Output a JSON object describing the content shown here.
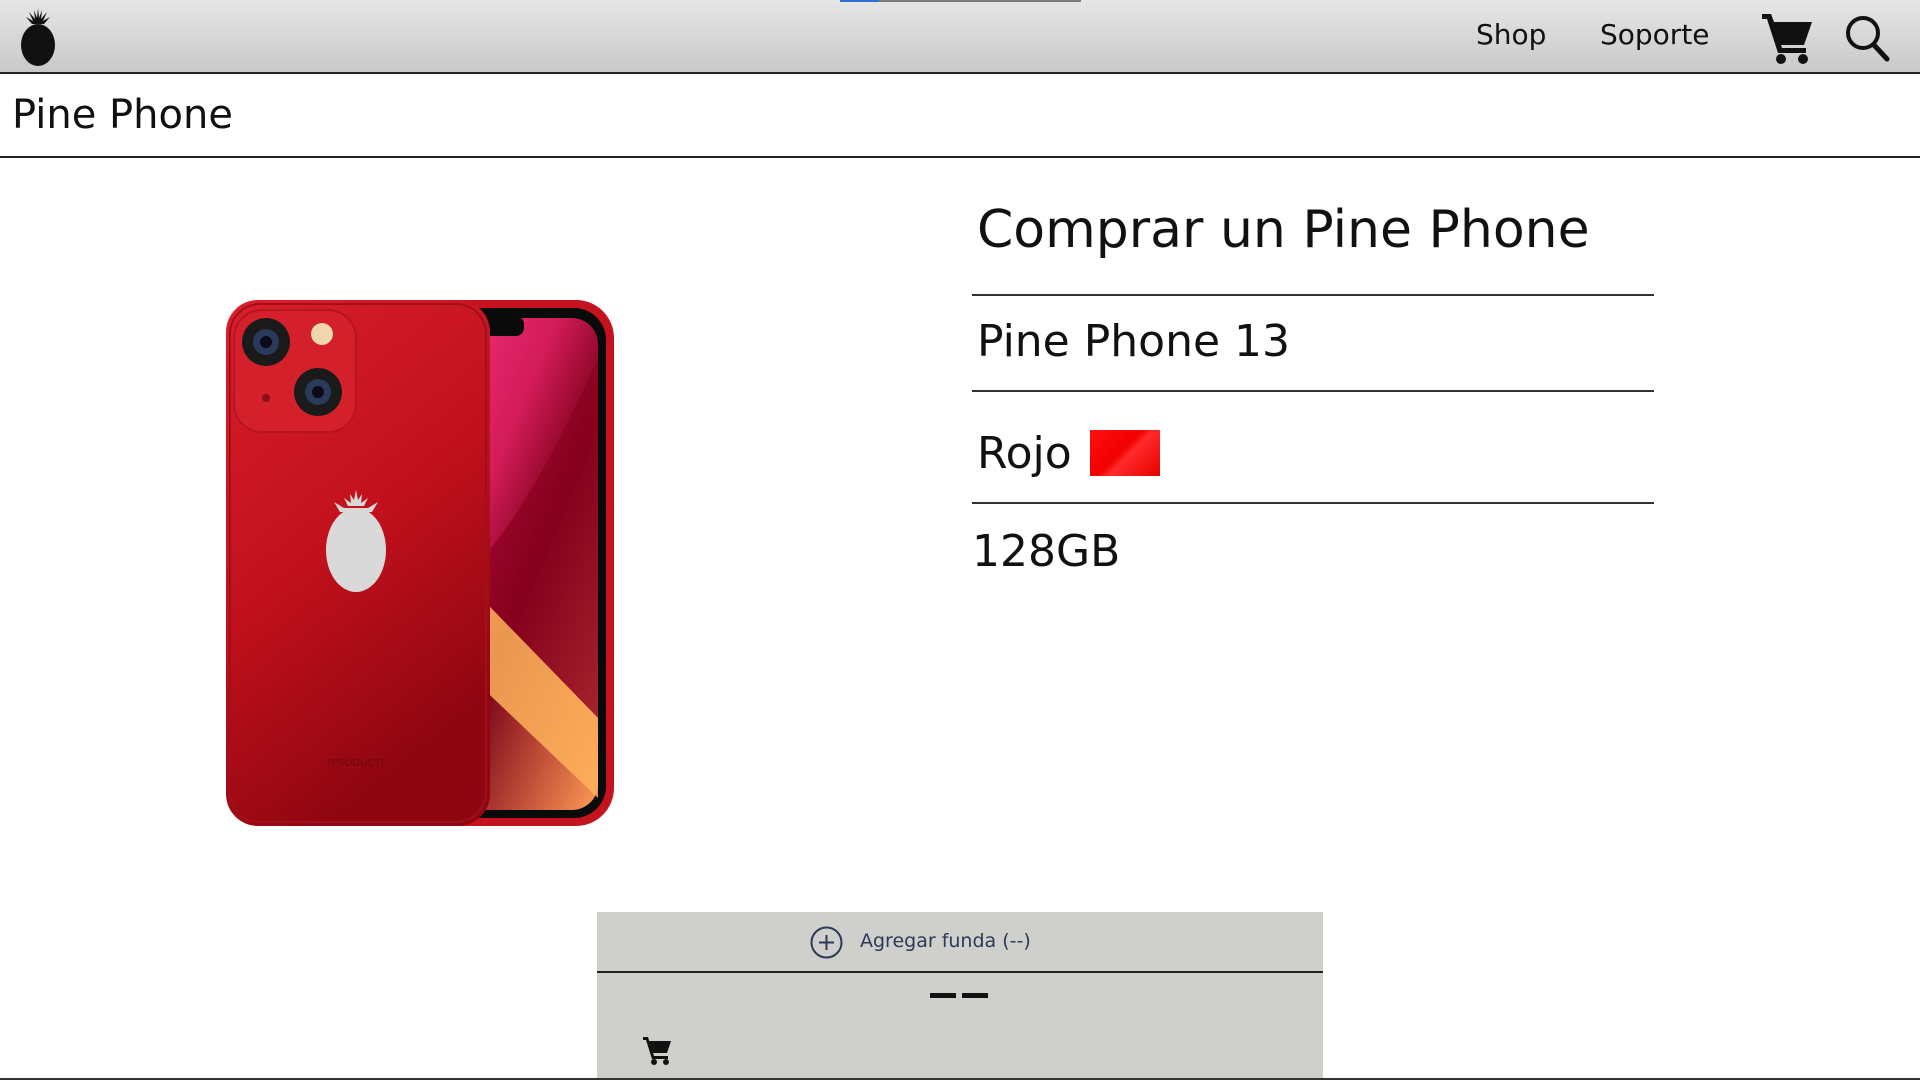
{
  "nav": {
    "shop_label": "Shop",
    "support_label": "Soporte",
    "cart_icon": "cart-icon",
    "search_icon": "search-icon",
    "logo_icon": "pineapple-logo",
    "load_progress": 0.16
  },
  "page": {
    "title": "Pine Phone"
  },
  "product": {
    "heading": "Comprar un Pine Phone",
    "model": "Pine Phone 13",
    "color_label": "Rojo",
    "color_hex": "#f00000",
    "storage": "128GB",
    "image_icon": "red-phone-image"
  },
  "add_panel": {
    "add_label": "Agregar funda (--)",
    "price_placeholder": "--",
    "plus_icon": "plus-circle-icon",
    "cart_icon": "cart-icon",
    "background": "#cfcfcb",
    "label_color": "#2b3a56"
  }
}
